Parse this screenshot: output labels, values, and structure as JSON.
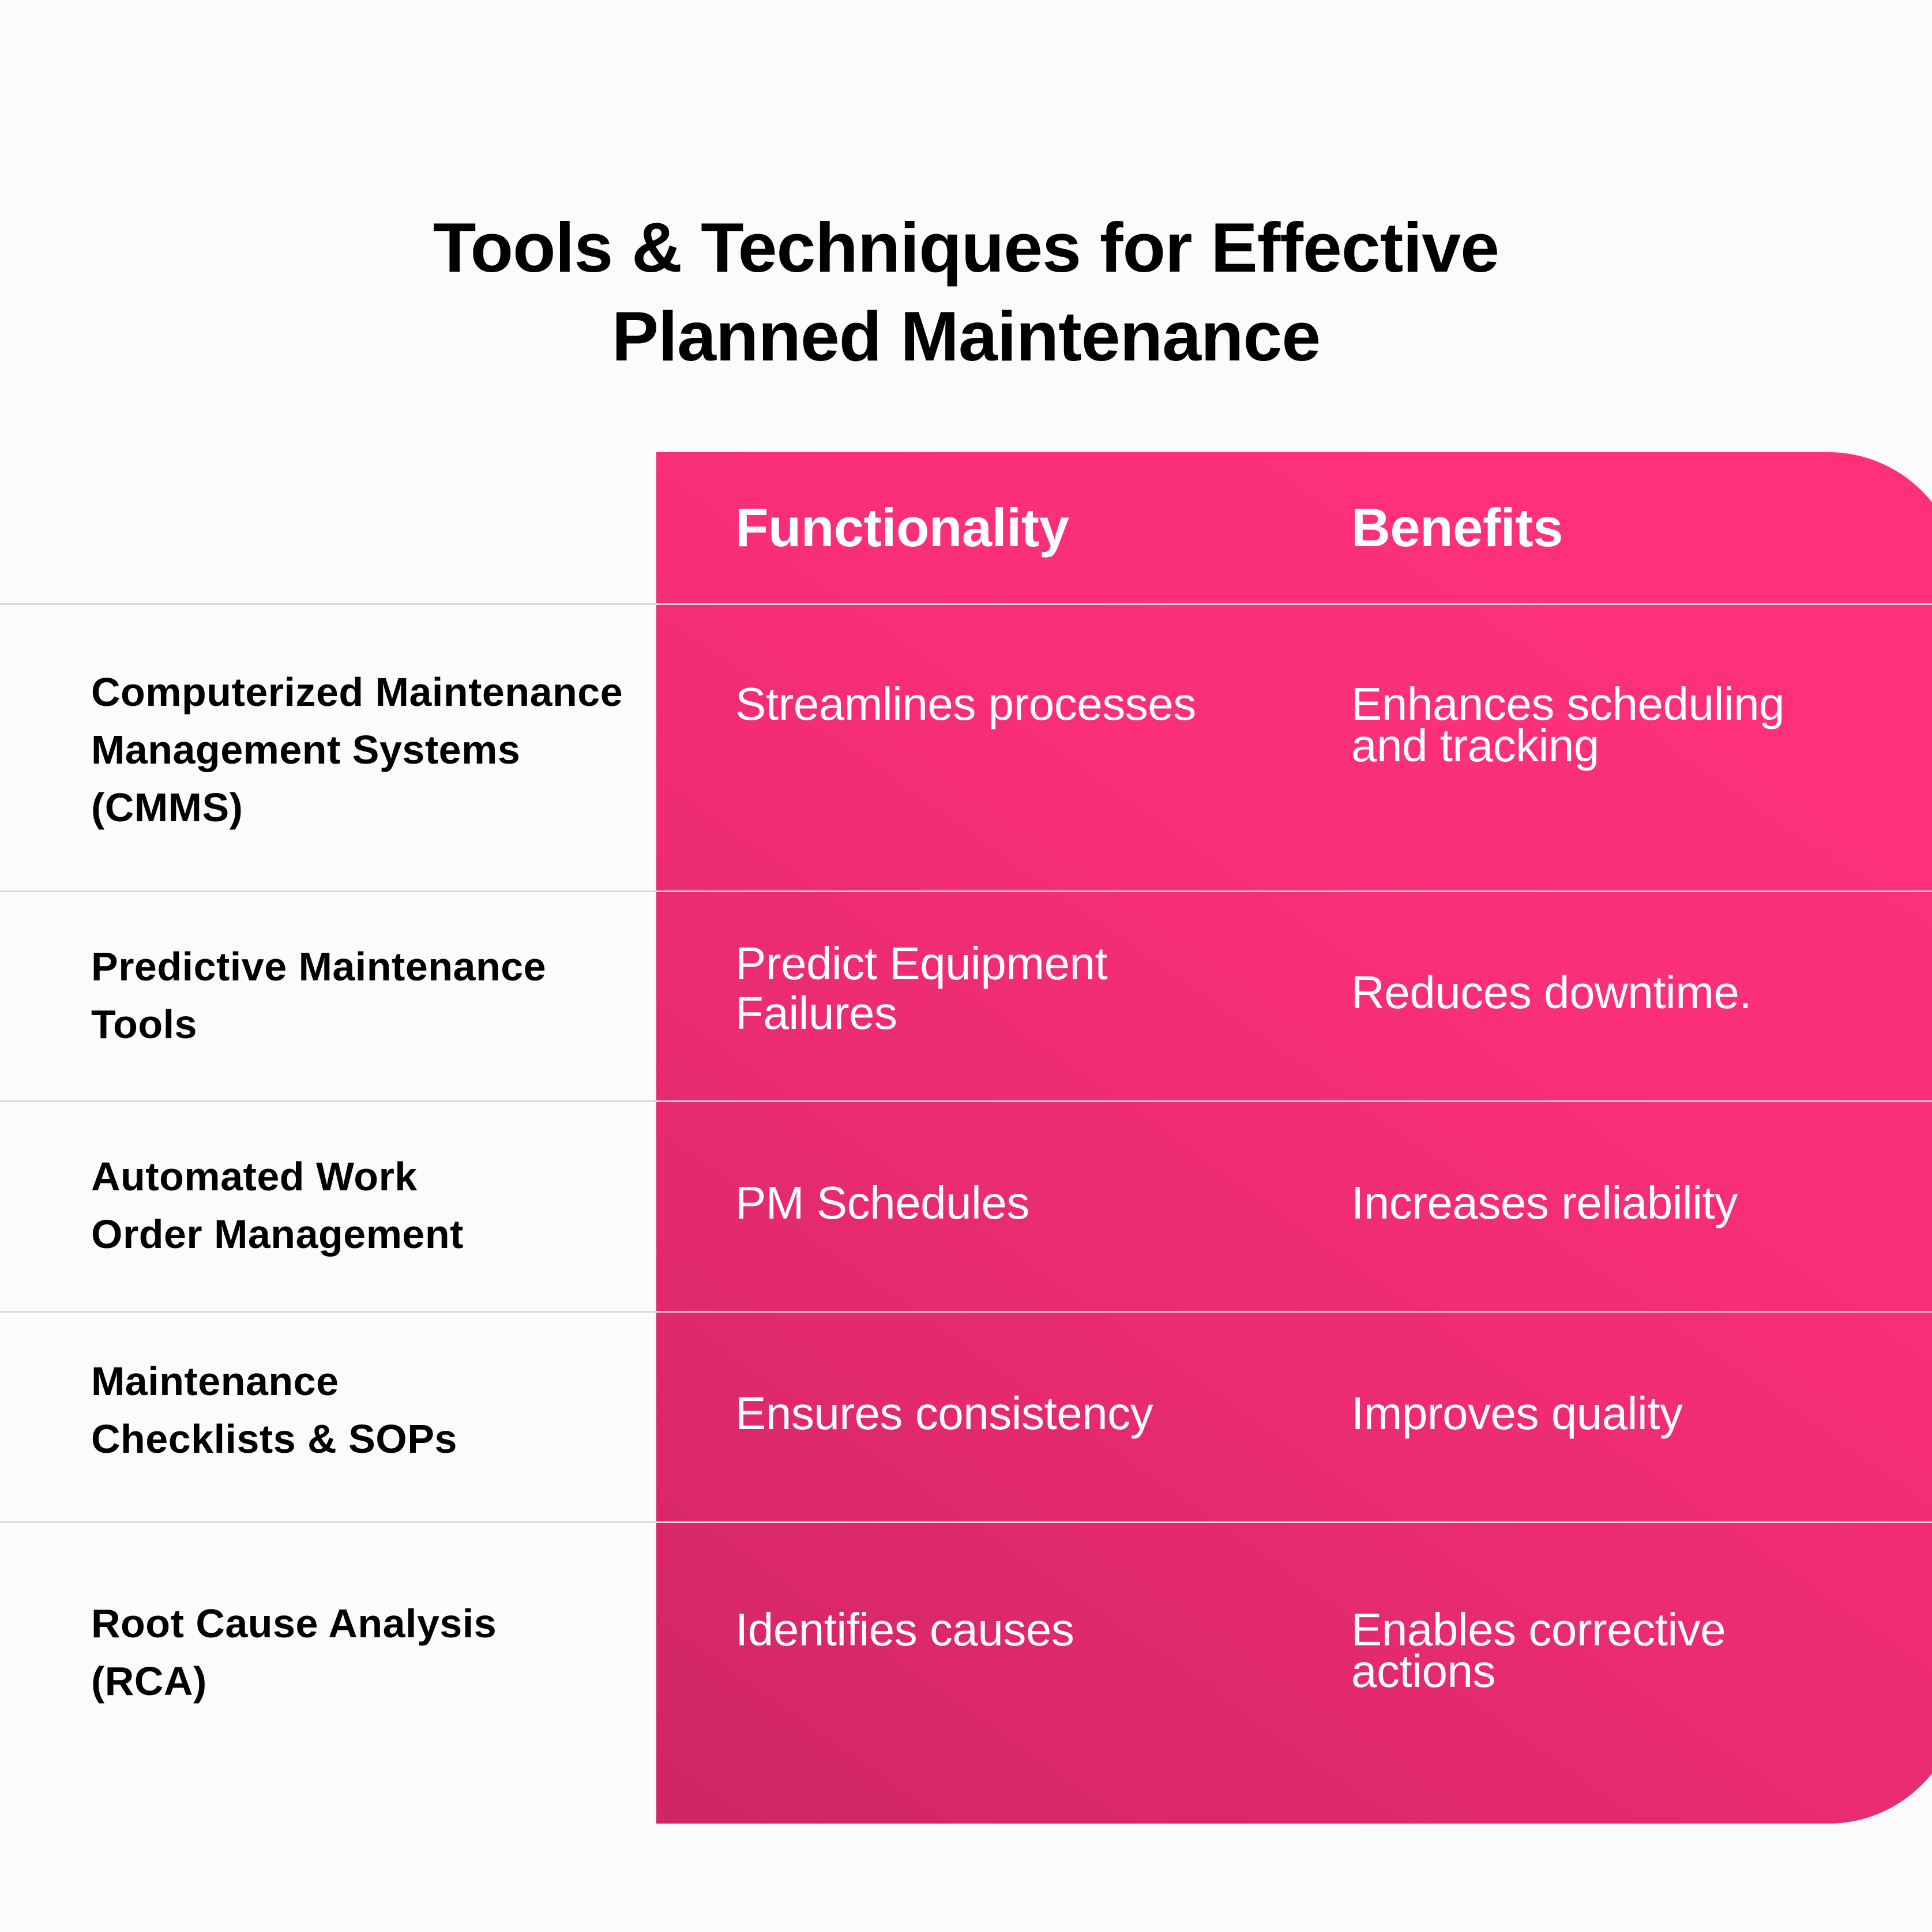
{
  "title": {
    "line1": "Tools & Techniques for Effective",
    "line2": "Planned Maintenance"
  },
  "colors": {
    "accent": "#ff3079",
    "accent_dark": "#cf2664",
    "background": "#fbfbfb",
    "divider": "#d9d9d9",
    "text_dark": "#000000",
    "text_light": "#ffffff"
  },
  "table": {
    "headers": {
      "tool": "",
      "functionality": "Functionality",
      "benefits": "Benefits"
    },
    "rows": [
      {
        "tool": "Computerized Maintenance Management Systems (CMMS)",
        "functionality": "Streamlines processes",
        "benefits": "Enhances scheduling and tracking"
      },
      {
        "tool": "Predictive Maintenance Tools",
        "functionality": "Predict Equipment Failures",
        "benefits": "Reduces downtime."
      },
      {
        "tool": "Automated Work Order Management",
        "functionality": "PM Schedules",
        "benefits": "Increases reliability"
      },
      {
        "tool": "Maintenance Checklists & SOPs",
        "functionality": "Ensures consistency",
        "benefits": "Improves quality"
      },
      {
        "tool": "Root Cause Analysis (RCA)",
        "functionality": "Identifies causes",
        "benefits": "Enables corrective actions"
      }
    ]
  }
}
